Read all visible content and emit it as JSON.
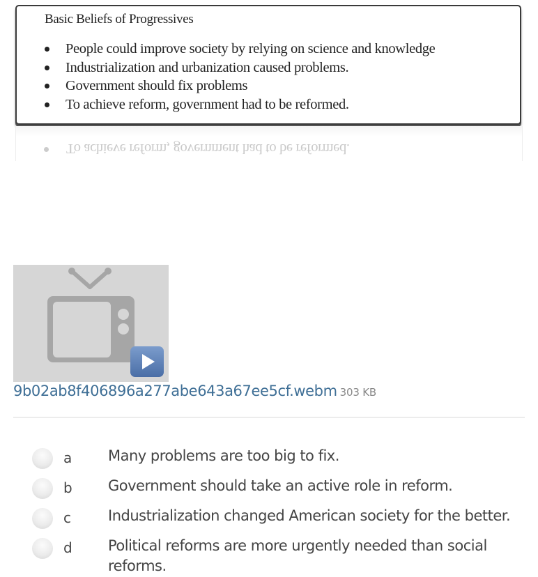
{
  "beliefs": {
    "title": "Basic Beliefs of Progressives",
    "items": [
      "People could improve society by relying on science and knowledge",
      "Industrialization and urbanization caused problems.",
      "Government should fix problems",
      "To achieve reform, government had to be reformed."
    ],
    "reflection_text": "To achieve reform, government had to be reformed."
  },
  "attachment": {
    "icon": "tv-icon",
    "play_icon": "play-icon",
    "filename": "9b02ab8f406896a277abe643a67ee5cf.webm",
    "size": "303 KB",
    "colors": {
      "link": "#3f6f96",
      "thumb_bg": "#d6d6d6",
      "play_button": "#5b80b5"
    }
  },
  "question": {
    "options": [
      {
        "letter": "a",
        "text": "Many problems are too big to fix.",
        "selected": false
      },
      {
        "letter": "b",
        "text": "Government should take an active role in reform.",
        "selected": false
      },
      {
        "letter": "c",
        "text": "Industrialization changed American society for the better.",
        "selected": false
      },
      {
        "letter": "d",
        "text": "Political reforms are more urgently needed than social reforms.",
        "selected": false
      }
    ]
  }
}
